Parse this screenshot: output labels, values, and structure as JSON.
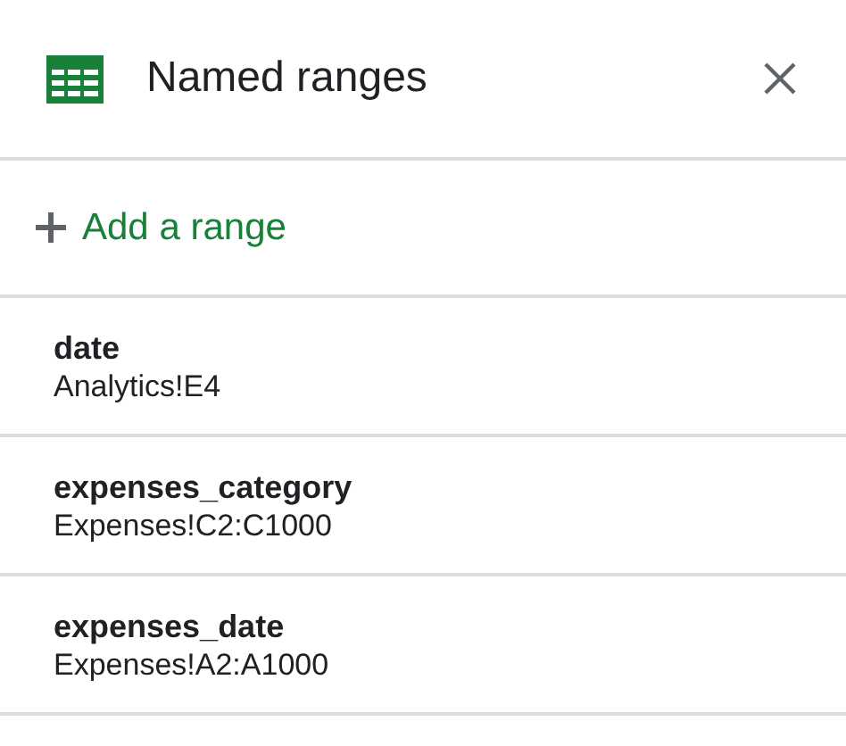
{
  "panel": {
    "title": "Named ranges"
  },
  "add_action": {
    "label": "Add a range"
  },
  "ranges": [
    {
      "name": "date",
      "range": "Analytics!E4"
    },
    {
      "name": "expenses_category",
      "range": "Expenses!C2:C1000"
    },
    {
      "name": "expenses_date",
      "range": "Expenses!A2:A1000"
    }
  ]
}
